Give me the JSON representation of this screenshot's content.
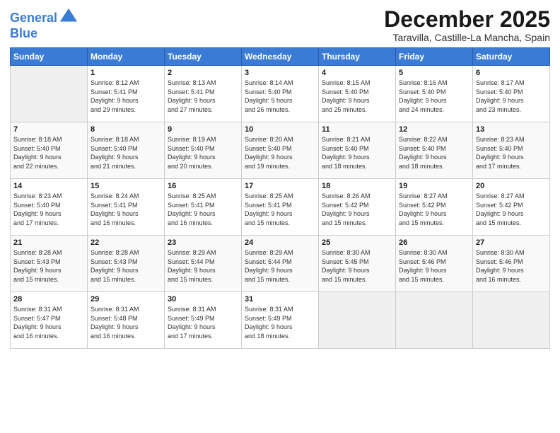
{
  "logo": {
    "line1": "General",
    "line2": "Blue"
  },
  "title": "December 2025",
  "subtitle": "Taravilla, Castille-La Mancha, Spain",
  "days_of_week": [
    "Sunday",
    "Monday",
    "Tuesday",
    "Wednesday",
    "Thursday",
    "Friday",
    "Saturday"
  ],
  "weeks": [
    [
      {
        "day": "",
        "info": ""
      },
      {
        "day": "1",
        "info": "Sunrise: 8:12 AM\nSunset: 5:41 PM\nDaylight: 9 hours\nand 29 minutes."
      },
      {
        "day": "2",
        "info": "Sunrise: 8:13 AM\nSunset: 5:41 PM\nDaylight: 9 hours\nand 27 minutes."
      },
      {
        "day": "3",
        "info": "Sunrise: 8:14 AM\nSunset: 5:40 PM\nDaylight: 9 hours\nand 26 minutes."
      },
      {
        "day": "4",
        "info": "Sunrise: 8:15 AM\nSunset: 5:40 PM\nDaylight: 9 hours\nand 25 minutes."
      },
      {
        "day": "5",
        "info": "Sunrise: 8:16 AM\nSunset: 5:40 PM\nDaylight: 9 hours\nand 24 minutes."
      },
      {
        "day": "6",
        "info": "Sunrise: 8:17 AM\nSunset: 5:40 PM\nDaylight: 9 hours\nand 23 minutes."
      }
    ],
    [
      {
        "day": "7",
        "info": "Sunrise: 8:18 AM\nSunset: 5:40 PM\nDaylight: 9 hours\nand 22 minutes."
      },
      {
        "day": "8",
        "info": "Sunrise: 8:18 AM\nSunset: 5:40 PM\nDaylight: 9 hours\nand 21 minutes."
      },
      {
        "day": "9",
        "info": "Sunrise: 8:19 AM\nSunset: 5:40 PM\nDaylight: 9 hours\nand 20 minutes."
      },
      {
        "day": "10",
        "info": "Sunrise: 8:20 AM\nSunset: 5:40 PM\nDaylight: 9 hours\nand 19 minutes."
      },
      {
        "day": "11",
        "info": "Sunrise: 8:21 AM\nSunset: 5:40 PM\nDaylight: 9 hours\nand 18 minutes."
      },
      {
        "day": "12",
        "info": "Sunrise: 8:22 AM\nSunset: 5:40 PM\nDaylight: 9 hours\nand 18 minutes."
      },
      {
        "day": "13",
        "info": "Sunrise: 8:23 AM\nSunset: 5:40 PM\nDaylight: 9 hours\nand 17 minutes."
      }
    ],
    [
      {
        "day": "14",
        "info": "Sunrise: 8:23 AM\nSunset: 5:40 PM\nDaylight: 9 hours\nand 17 minutes."
      },
      {
        "day": "15",
        "info": "Sunrise: 8:24 AM\nSunset: 5:41 PM\nDaylight: 9 hours\nand 16 minutes."
      },
      {
        "day": "16",
        "info": "Sunrise: 8:25 AM\nSunset: 5:41 PM\nDaylight: 9 hours\nand 16 minutes."
      },
      {
        "day": "17",
        "info": "Sunrise: 8:25 AM\nSunset: 5:41 PM\nDaylight: 9 hours\nand 15 minutes."
      },
      {
        "day": "18",
        "info": "Sunrise: 8:26 AM\nSunset: 5:42 PM\nDaylight: 9 hours\nand 15 minutes."
      },
      {
        "day": "19",
        "info": "Sunrise: 8:27 AM\nSunset: 5:42 PM\nDaylight: 9 hours\nand 15 minutes."
      },
      {
        "day": "20",
        "info": "Sunrise: 8:27 AM\nSunset: 5:42 PM\nDaylight: 9 hours\nand 15 minutes."
      }
    ],
    [
      {
        "day": "21",
        "info": "Sunrise: 8:28 AM\nSunset: 5:43 PM\nDaylight: 9 hours\nand 15 minutes."
      },
      {
        "day": "22",
        "info": "Sunrise: 8:28 AM\nSunset: 5:43 PM\nDaylight: 9 hours\nand 15 minutes."
      },
      {
        "day": "23",
        "info": "Sunrise: 8:29 AM\nSunset: 5:44 PM\nDaylight: 9 hours\nand 15 minutes."
      },
      {
        "day": "24",
        "info": "Sunrise: 8:29 AM\nSunset: 5:44 PM\nDaylight: 9 hours\nand 15 minutes."
      },
      {
        "day": "25",
        "info": "Sunrise: 8:30 AM\nSunset: 5:45 PM\nDaylight: 9 hours\nand 15 minutes."
      },
      {
        "day": "26",
        "info": "Sunrise: 8:30 AM\nSunset: 5:46 PM\nDaylight: 9 hours\nand 15 minutes."
      },
      {
        "day": "27",
        "info": "Sunrise: 8:30 AM\nSunset: 5:46 PM\nDaylight: 9 hours\nand 16 minutes."
      }
    ],
    [
      {
        "day": "28",
        "info": "Sunrise: 8:31 AM\nSunset: 5:47 PM\nDaylight: 9 hours\nand 16 minutes."
      },
      {
        "day": "29",
        "info": "Sunrise: 8:31 AM\nSunset: 5:48 PM\nDaylight: 9 hours\nand 16 minutes."
      },
      {
        "day": "30",
        "info": "Sunrise: 8:31 AM\nSunset: 5:49 PM\nDaylight: 9 hours\nand 17 minutes."
      },
      {
        "day": "31",
        "info": "Sunrise: 8:31 AM\nSunset: 5:49 PM\nDaylight: 9 hours\nand 18 minutes."
      },
      {
        "day": "",
        "info": ""
      },
      {
        "day": "",
        "info": ""
      },
      {
        "day": "",
        "info": ""
      }
    ]
  ]
}
